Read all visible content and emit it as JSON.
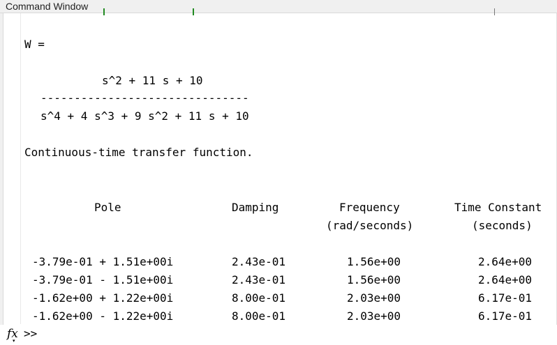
{
  "window": {
    "title": "Command Window"
  },
  "output": {
    "var_label": "W =",
    "numerator": "s^2 + 11 s + 10",
    "fraction_bar": "-------------------------------",
    "denominator": "s^4 + 4 s^3 + 9 s^2 + 11 s + 10",
    "description": "Continuous-time transfer function.",
    "table": {
      "headers": {
        "pole": "Pole",
        "damping": "Damping",
        "frequency": "Frequency",
        "time_constant": "Time Constant",
        "frequency_unit": "(rad/seconds)",
        "time_constant_unit": "(seconds)"
      },
      "rows": [
        {
          "pole": "-3.79e-01 + 1.51e+00i",
          "damping": "2.43e-01",
          "frequency": "1.56e+00",
          "time_constant": "2.64e+00"
        },
        {
          "pole": "-3.79e-01 - 1.51e+00i",
          "damping": "2.43e-01",
          "frequency": "1.56e+00",
          "time_constant": "2.64e+00"
        },
        {
          "pole": "-1.62e+00 + 1.22e+00i",
          "damping": "8.00e-01",
          "frequency": "2.03e+00",
          "time_constant": "6.17e-01"
        },
        {
          "pole": "-1.62e+00 - 1.22e+00i",
          "damping": "8.00e-01",
          "frequency": "2.03e+00",
          "time_constant": "6.17e-01"
        }
      ]
    }
  },
  "prompt": {
    "fx_icon": "fx-icon",
    "symbol": ">>"
  },
  "colors": {
    "title_bar": "#f0f0f0",
    "cut_off_text": "#228b22"
  }
}
